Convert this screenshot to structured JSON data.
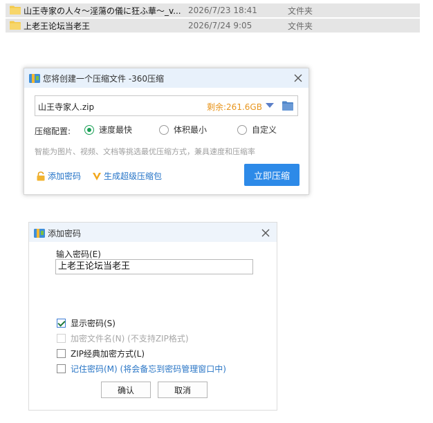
{
  "files": [
    {
      "name": "山王寺家の人々～淫蕩の儀に狂ふ華～_v...",
      "date": "2026/7/23 18:41",
      "type": "文件夹"
    },
    {
      "name": "上老王论坛当老王",
      "date": "2026/7/24 9:05",
      "type": "文件夹"
    }
  ],
  "compress_dialog": {
    "title": "您将创建一个压缩文件 -360压缩",
    "filename": "山王寺家人.zip",
    "free_space": "剩余:261.6GB",
    "config_label": "压缩配置:",
    "options": [
      "速度最快",
      "体积最小",
      "自定义"
    ],
    "selected": "速度最快",
    "hint": "智能为图片、视频、文档等挑选最优压缩方式，兼具速度和压缩率",
    "add_password": "添加密码",
    "super_pack": "生成超级压缩包",
    "compress_button": "立即压缩",
    "colors": {
      "accent": "#2d8ae8",
      "free_space": "#e8951d",
      "radio": "#1aa056"
    }
  },
  "password_dialog": {
    "title": "添加密码",
    "input_label": "输入密码(E)",
    "password_value": "上老王论坛当老王",
    "show_password": "显示密码(S)",
    "encrypt_names": "加密文件名(N) (不支持ZIP格式)",
    "zip_classic": "ZIP经典加密方式(L)",
    "remember": "记住密码(M)",
    "remember_note": "(将会备忘到密码管理窗口中)",
    "ok": "确认",
    "cancel": "取消"
  }
}
